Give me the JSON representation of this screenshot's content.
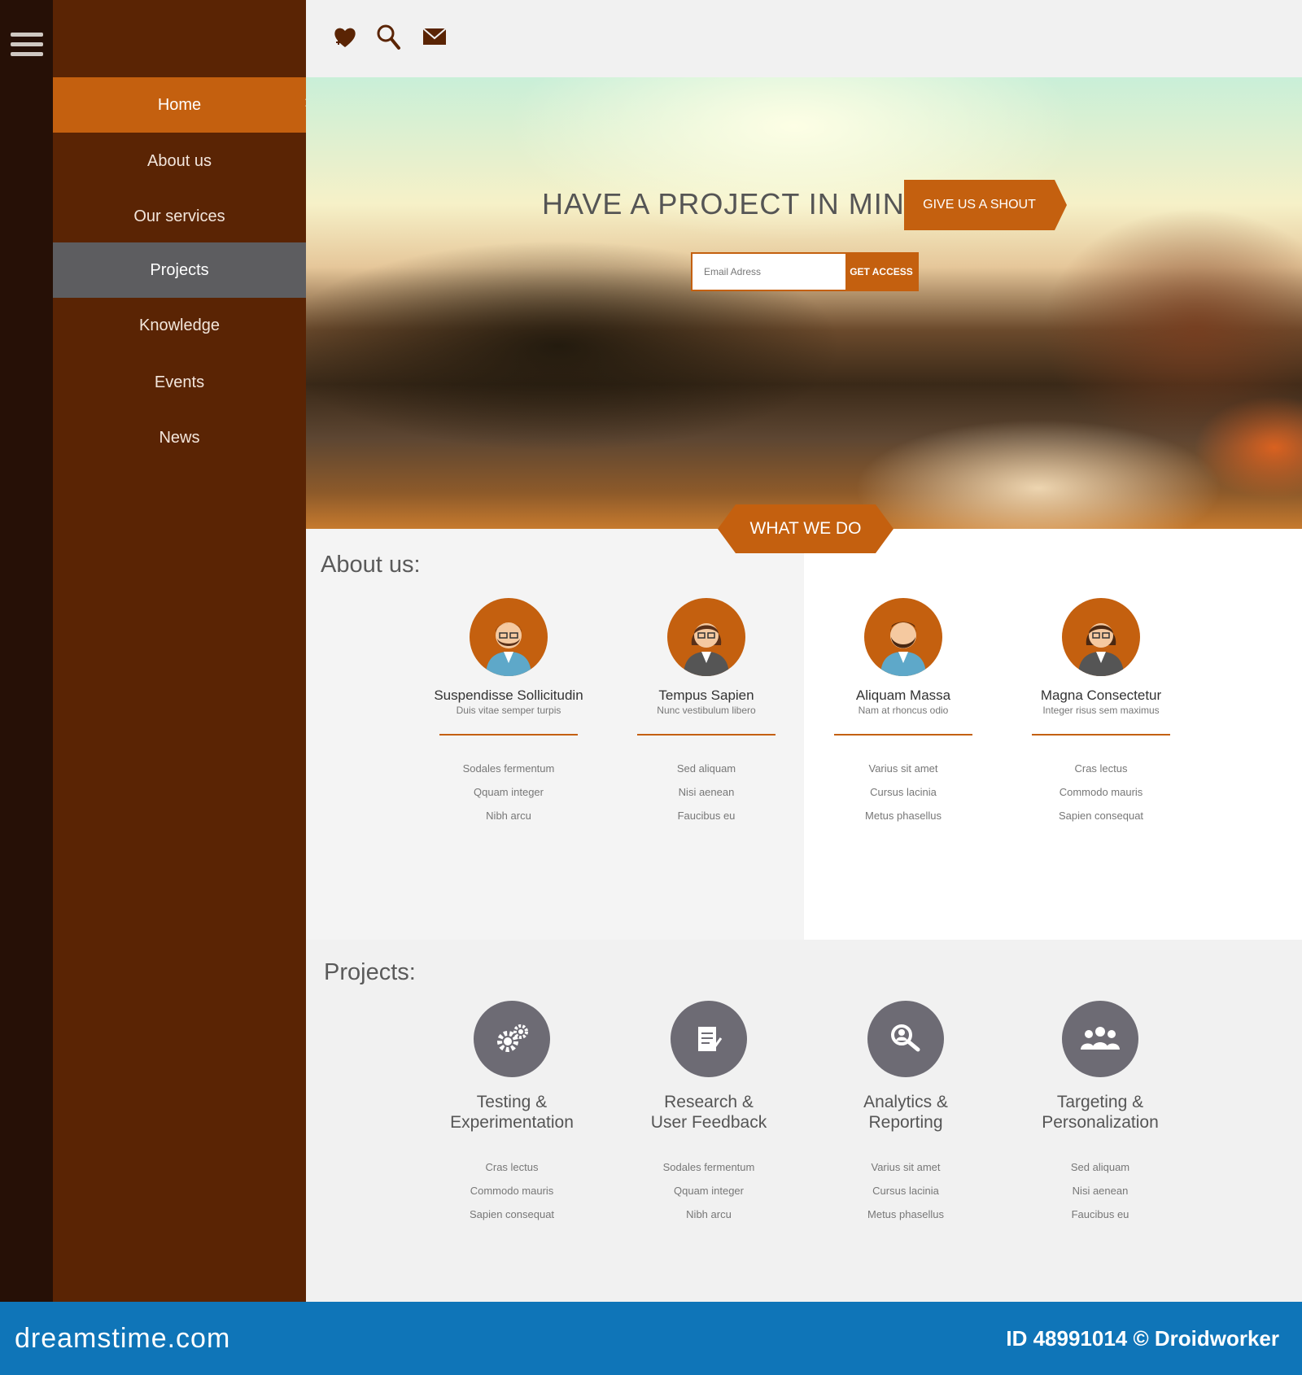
{
  "sidebar": {
    "menu_icon": "hamburger-menu-icon",
    "items": [
      {
        "label": "Home",
        "state": "active"
      },
      {
        "label": "About us",
        "state": ""
      },
      {
        "label": "Our services",
        "state": ""
      },
      {
        "label": "Projects",
        "state": "selected"
      },
      {
        "label": "Knowledge",
        "state": ""
      },
      {
        "label": "Events",
        "state": ""
      },
      {
        "label": "News",
        "state": ""
      }
    ],
    "active_arrow_icon": "chevron-right-icon"
  },
  "topbar": {
    "icons": [
      "heart-plus-icon",
      "search-icon",
      "mail-icon"
    ]
  },
  "hero": {
    "title": "HAVE A PROJECT IN MIND?",
    "shout_label": "GIVE US A SHOUT",
    "email_placeholder": "Email Adress",
    "access_label": "GET ACCESS",
    "tab_label": "WHAT WE DO"
  },
  "about": {
    "title": "About us:",
    "people": [
      {
        "name": "Suspendisse Sollicitudin",
        "role": "Duis vitae semper turpis",
        "items": [
          "Sodales fermentum",
          "Qquam integer",
          "Nibh arcu"
        ],
        "gender": "male-glasses"
      },
      {
        "name": "Tempus Sapien",
        "role": "Nunc vestibulum libero",
        "items": [
          "Sed aliquam",
          "Nisi aenean",
          "Faucibus eu"
        ],
        "gender": "female"
      },
      {
        "name": "Aliquam Massa",
        "role": "Nam at rhoncus odio",
        "items": [
          "Varius sit amet",
          "Cursus lacinia",
          "Metus phasellus"
        ],
        "gender": "male-beard"
      },
      {
        "name": "Magna Consectetur",
        "role": "Integer risus sem maximus",
        "items": [
          "Cras lectus",
          "Commodo mauris",
          "Sapien consequat"
        ],
        "gender": "female"
      }
    ]
  },
  "projects": {
    "title": "Projects:",
    "items": [
      {
        "title_line1": "Testing &",
        "title_line2": "Experimentation",
        "icon": "gears-icon",
        "items": [
          "Cras lectus",
          "Commodo mauris",
          "Sapien consequat"
        ]
      },
      {
        "title_line1": "Research &",
        "title_line2": "User Feedback",
        "icon": "clipboard-icon",
        "items": [
          "Sodales fermentum",
          "Qquam integer",
          "Nibh arcu"
        ]
      },
      {
        "title_line1": "Analytics &",
        "title_line2": "Reporting",
        "icon": "magnify-person-icon",
        "items": [
          "Varius sit amet",
          "Cursus lacinia",
          "Metus phasellus"
        ]
      },
      {
        "title_line1": "Targeting &",
        "title_line2": "Personalization",
        "icon": "group-icon",
        "items": [
          "Sed aliquam",
          "Nisi aenean",
          "Faucibus eu"
        ]
      }
    ]
  },
  "footer": {
    "left": "dreamstime.com",
    "right": "ID 48991014 © Droidworker"
  },
  "colors": {
    "accent": "#c4600f",
    "sidebar": "#5a2404",
    "rail": "#261006",
    "selected": "#5d5d60",
    "footer": "#0f75b8"
  }
}
